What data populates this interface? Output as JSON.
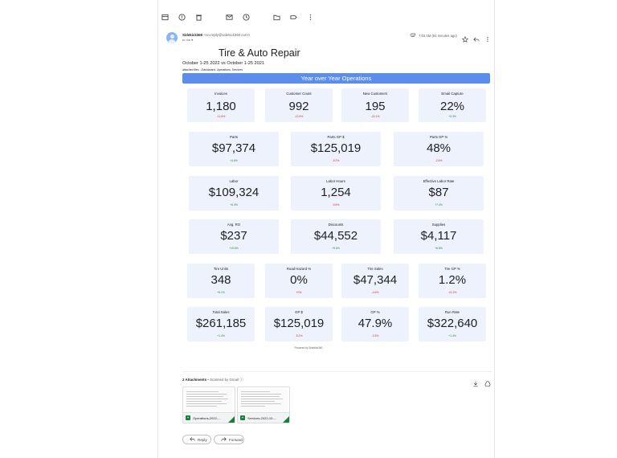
{
  "toolbar": {
    "icons": [
      "archive-icon",
      "report-spam-icon",
      "delete-icon",
      "mark-unread-icon",
      "snooze-icon",
      "move-to-icon",
      "label-icon",
      "more-vert-icon"
    ]
  },
  "email": {
    "sender_name": "Sidekick360",
    "sender_address": "<no-reply@sidekick360.com>",
    "to_line": "to me",
    "time": "7:03 AM (54 minutes ago)"
  },
  "report": {
    "title": "Tire & Auto Repair",
    "subtitle": "October 1-25 2022 vs October 1-25 2021",
    "attached_files": "attached files : Dashboard, Operations, Services",
    "banner": "Year over Year Operations",
    "powered_by": "Powered by Sidekick360"
  },
  "metrics": {
    "row1": [
      {
        "label": "Invoices",
        "value": "1,180",
        "change": "-11.8%",
        "trend": "neg"
      },
      {
        "label": "Customer Count",
        "value": "992",
        "change": "-12.6%",
        "trend": "neg"
      },
      {
        "label": "New Customers",
        "value": "195",
        "change": "-24.1%",
        "trend": "neg"
      },
      {
        "label": "Email Capture",
        "value": "22%",
        "change": "+3.3%",
        "trend": "pos"
      }
    ],
    "row2": [
      {
        "label": "Parts",
        "value": "$97,374",
        "change": "+4.6%",
        "trend": "pos"
      },
      {
        "label": "Parts GP $",
        "value": "$125,019",
        "change": "-5.2%",
        "trend": "neg"
      },
      {
        "label": "Parts GP %",
        "value": "48%",
        "change": "-2.5%",
        "trend": "neg"
      }
    ],
    "row3": [
      {
        "label": "Labor",
        "value": "$109,324",
        "change": "+6.3%",
        "trend": "pos"
      },
      {
        "label": "Labor Hours",
        "value": "1,254",
        "change": "-9.5%",
        "trend": "neg"
      },
      {
        "label": "Effective Labor Rate",
        "value": "$87",
        "change": "+7.4%",
        "trend": "pos"
      }
    ],
    "row4": [
      {
        "label": "Avg. RO",
        "value": "$237",
        "change": "+19.6%",
        "trend": "pos"
      },
      {
        "label": "Discounts",
        "value": "$44,552",
        "change": "+9.6%",
        "trend": "pos"
      },
      {
        "label": "Supplies",
        "value": "$4,117",
        "change": "+6.8%",
        "trend": "pos"
      }
    ],
    "row5": [
      {
        "label": "Tire Units",
        "value": "348",
        "change": "+6.1%",
        "trend": "pos"
      },
      {
        "label": "Road Hazard %",
        "value": "0%",
        "change": "+0%",
        "trend": "neg"
      },
      {
        "label": "Tire Sales",
        "value": "$47,344",
        "change": "-4.6%",
        "trend": "neg"
      },
      {
        "label": "Tire GP %",
        "value": "1.2%",
        "change": "-21.3%",
        "trend": "neg"
      }
    ],
    "row6": [
      {
        "label": "Total Sales",
        "value": "$261,185",
        "change": "+1.4%",
        "trend": "pos"
      },
      {
        "label": "GP $",
        "value": "$125,019",
        "change": "-5.2%",
        "trend": "neg"
      },
      {
        "label": "GP %",
        "value": "47.9%",
        "change": "-3.3%",
        "trend": "neg"
      },
      {
        "label": "Run Rate",
        "value": "$322,640",
        "change": "+1.4%",
        "trend": "pos"
      }
    ]
  },
  "attachments": {
    "count_label": "2 Attachments",
    "scanned_label": "Scanned by Gmail",
    "files": [
      {
        "name": "Operations-2022-...",
        "icon": "sheets-icon"
      },
      {
        "name": "Services-2022-10-...",
        "icon": "sheets-icon"
      }
    ]
  },
  "actions": {
    "reply_label": "Reply",
    "forward_label": "Forward"
  },
  "colors": {
    "banner": "#5b8def",
    "card_bg": "#eef2fd",
    "negative": "#d93025",
    "positive": "#1e8e3e"
  }
}
